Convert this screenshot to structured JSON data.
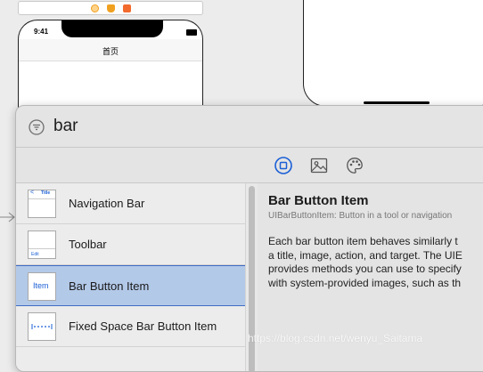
{
  "storyboard": {
    "phone_time": "9:41",
    "nav_title": "首页"
  },
  "library": {
    "search": {
      "value": "bar",
      "placeholder": "Filter"
    },
    "tabs": [
      {
        "icon": "objects-square-icon",
        "selected": true
      },
      {
        "icon": "image-icon",
        "selected": false
      },
      {
        "icon": "palette-icon",
        "selected": false
      }
    ],
    "items": [
      {
        "label": "Navigation Bar",
        "thumb_text": "Title",
        "selected": false
      },
      {
        "label": "Toolbar",
        "thumb_text": "Edit",
        "selected": false
      },
      {
        "label": "Bar Button Item",
        "thumb_text": "Item",
        "selected": true
      },
      {
        "label": "Fixed Space Bar Button Item",
        "thumb_text": "",
        "selected": false
      }
    ],
    "detail": {
      "title": "Bar Button Item",
      "subtitle": "UIBarButtonItem: Button in a tool or navigation",
      "body_lines": [
        "Each bar button item behaves similarly t",
        "a title, image, action, and target. The UIE",
        "provides methods you can use to specify",
        "with system-provided images, such as th"
      ]
    }
  },
  "watermark": "https://blog.csdn.net/wenyu_Saitama",
  "colors": {
    "accent": "#1a5fd6",
    "selection": "#b3c9e8",
    "selection_border": "#3f6bc4"
  }
}
